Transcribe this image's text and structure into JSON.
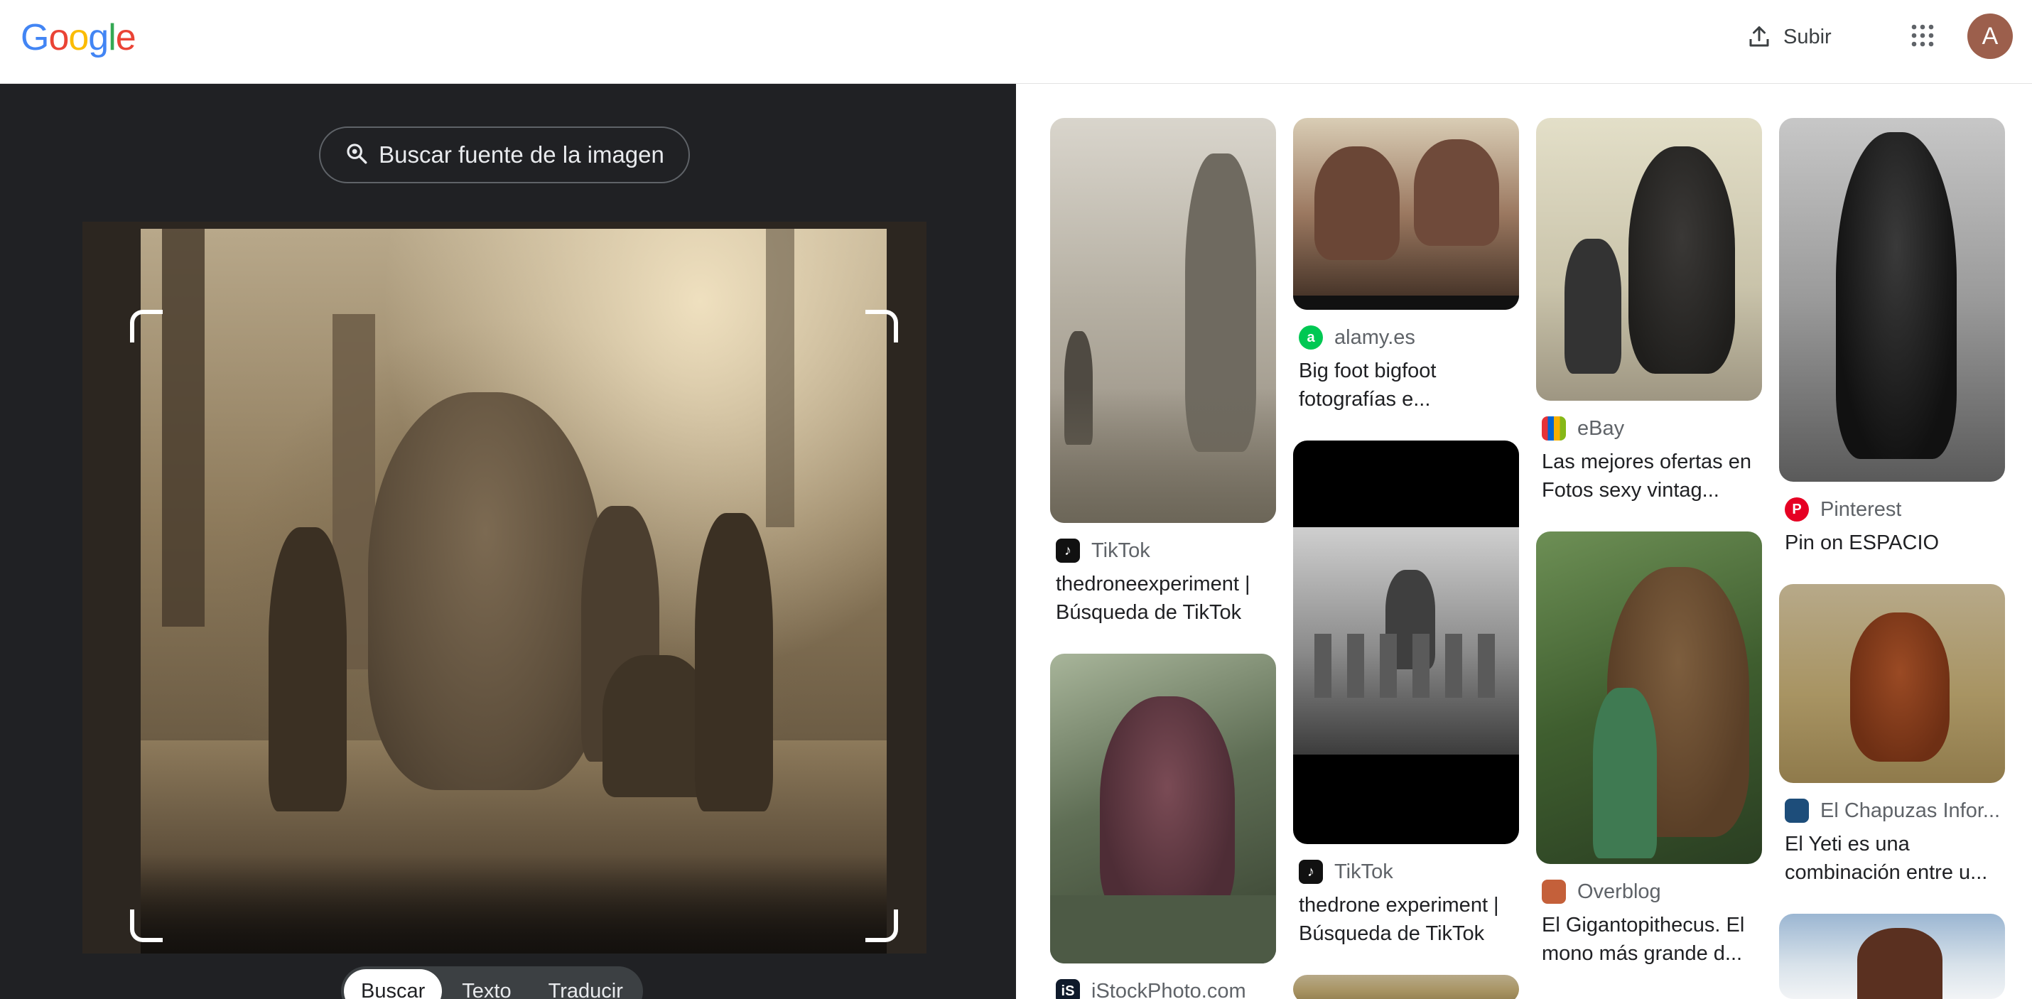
{
  "header": {
    "logo_letters": [
      "G",
      "o",
      "o",
      "g",
      "l",
      "e"
    ],
    "logo_colors": [
      "#4285F4",
      "#EA4335",
      "#FBBC05",
      "#4285F4",
      "#34A853",
      "#EA4335"
    ],
    "upload_label": "Subir",
    "avatar_initial": "A"
  },
  "lens": {
    "find_source_label": "Buscar fuente de la imagen",
    "tabs": [
      {
        "label": "Buscar",
        "active": true
      },
      {
        "label": "Texto",
        "active": false
      },
      {
        "label": "Traducir",
        "active": false
      }
    ]
  },
  "results": [
    {
      "source": "TikTok",
      "favicon": "tiktok-icon",
      "title": "thedroneexperiment | Búsqueda de TikTok"
    },
    {
      "source": "iStockPhoto.com",
      "favicon": "istock-icon",
      "title": ""
    },
    {
      "source": "alamy.es",
      "favicon": "alamy-icon",
      "title": "Big foot bigfoot fotografías e..."
    },
    {
      "source": "TikTok",
      "favicon": "tiktok-icon",
      "title": "thedrone experiment | Búsqueda de TikTok"
    },
    {
      "source": "eBay",
      "favicon": "ebay-icon",
      "title": "Las mejores ofertas en Fotos sexy vintag..."
    },
    {
      "source": "Overblog",
      "favicon": "overblog-icon",
      "title": "El Gigantopithecus. El mono más grande d..."
    },
    {
      "source": "Pinterest",
      "favicon": "pinterest-icon",
      "title": "Pin on ESPACIO"
    },
    {
      "source": "El Chapuzas Infor...",
      "favicon": "chapuzas-icon",
      "title": "El Yeti es una combinación entre u..."
    }
  ],
  "colors": {
    "left_panel_bg": "#202124",
    "pinterest": "#E60023",
    "alamy": "#00C853",
    "tiktok": "#111111"
  }
}
